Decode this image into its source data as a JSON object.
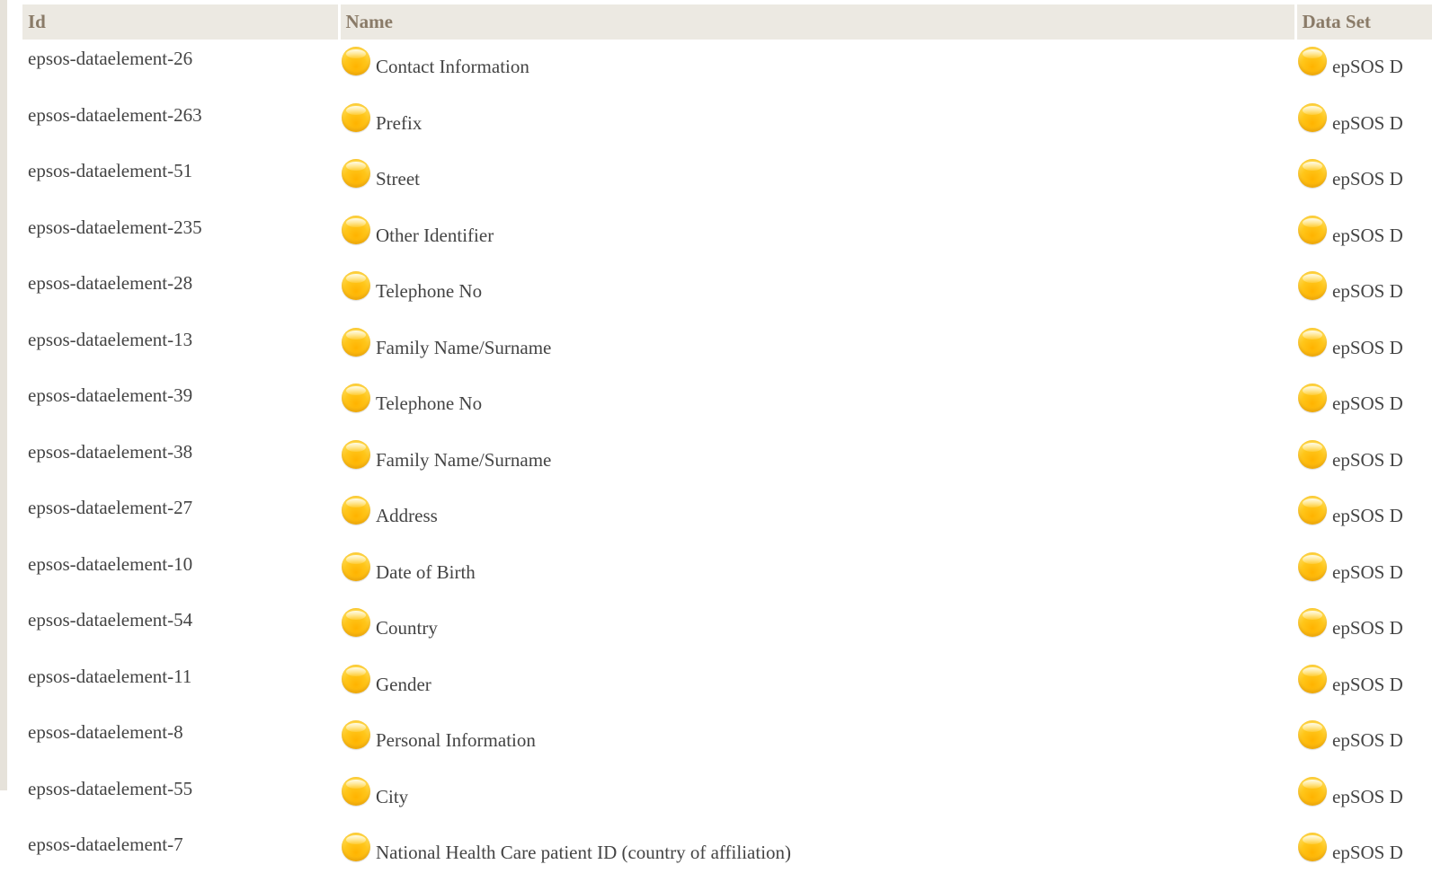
{
  "table": {
    "headers": {
      "id": "Id",
      "name": "Name",
      "dataset": "Data Set"
    },
    "rows": [
      {
        "id": "epsos-dataelement-26",
        "name": "Contact Information",
        "dataset": "epSOS D"
      },
      {
        "id": "epsos-dataelement-263",
        "name": "Prefix",
        "dataset": "epSOS D"
      },
      {
        "id": "epsos-dataelement-51",
        "name": "Street",
        "dataset": "epSOS D"
      },
      {
        "id": "epsos-dataelement-235",
        "name": "Other Identifier",
        "dataset": "epSOS D"
      },
      {
        "id": "epsos-dataelement-28",
        "name": "Telephone No",
        "dataset": "epSOS D"
      },
      {
        "id": "epsos-dataelement-13",
        "name": "Family Name/Surname",
        "dataset": "epSOS D"
      },
      {
        "id": "epsos-dataelement-39",
        "name": "Telephone No",
        "dataset": "epSOS D"
      },
      {
        "id": "epsos-dataelement-38",
        "name": "Family Name/Surname",
        "dataset": "epSOS D"
      },
      {
        "id": "epsos-dataelement-27",
        "name": "Address",
        "dataset": "epSOS D"
      },
      {
        "id": "epsos-dataelement-10",
        "name": "Date of Birth",
        "dataset": "epSOS D"
      },
      {
        "id": "epsos-dataelement-54",
        "name": "Country",
        "dataset": "epSOS D"
      },
      {
        "id": "epsos-dataelement-11",
        "name": "Gender",
        "dataset": "epSOS D"
      },
      {
        "id": "epsos-dataelement-8",
        "name": "Personal Information",
        "dataset": "epSOS D"
      },
      {
        "id": "epsos-dataelement-55",
        "name": "City",
        "dataset": "epSOS D"
      },
      {
        "id": "epsos-dataelement-7",
        "name": "National Health Care patient ID (country of affiliation)",
        "dataset": "epSOS D"
      }
    ]
  },
  "icons": {
    "status": "yellow-orb-icon"
  },
  "colors": {
    "header_bg": "#ece9e2",
    "header_text": "#8a7b68",
    "orb": "#ffc61a"
  }
}
